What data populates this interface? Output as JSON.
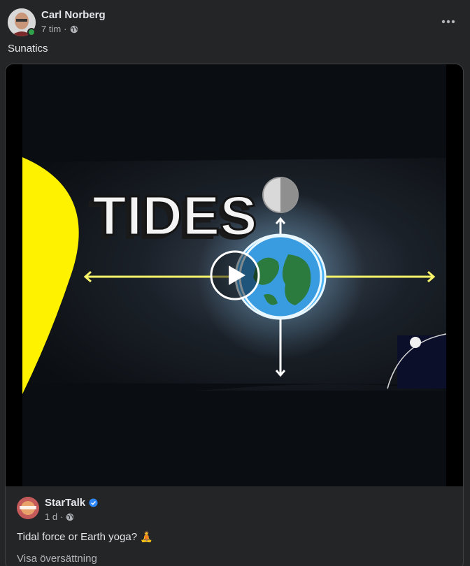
{
  "post": {
    "author": "Carl Norberg",
    "time": "7 tim",
    "separator": "·",
    "privacy_icon": "globe-icon",
    "more_icon": "more-horizontal-icon",
    "text": "Sunatics"
  },
  "shared": {
    "video": {
      "title_text": "TIDES",
      "play_icon": "play-icon"
    },
    "author": "StarTalk",
    "verified_icon": "verified-badge-icon",
    "time": "1 d",
    "separator": "·",
    "privacy_icon": "globe-icon",
    "text": "Tidal force or Earth yoga? 🧘",
    "translate_label": "Visa översättning"
  },
  "colors": {
    "background": "#242526",
    "primary_text": "#e4e6eb",
    "secondary_text": "#b0b3b8",
    "online": "#31a24c",
    "verified": "#2d88ff"
  }
}
